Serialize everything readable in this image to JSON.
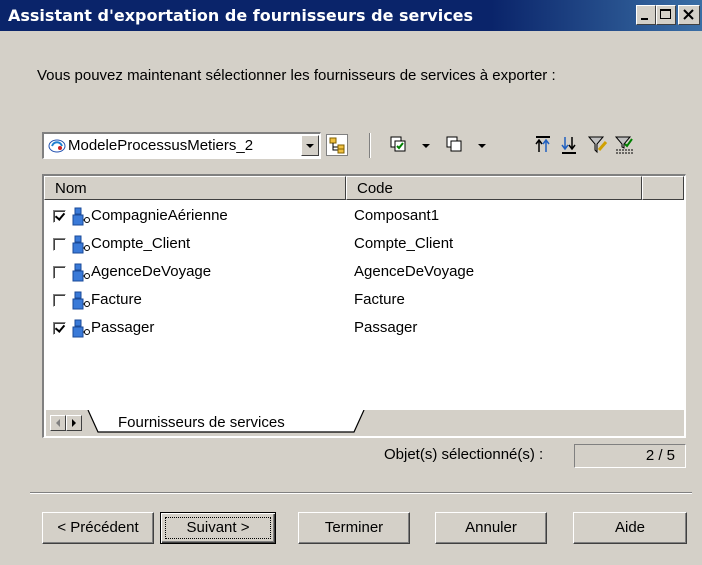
{
  "window": {
    "title": "Assistant d'exportation de fournisseurs de services",
    "controls": [
      "minimize-icon",
      "maximize-icon",
      "close-icon"
    ]
  },
  "instruction": "Vous pouvez maintenant sélectionner les fournisseurs de services à exporter :",
  "toolbar": {
    "model_selected": "ModeleProcessusMetiers_2",
    "tools": [
      "include-subpackages-icon",
      "select-all-icon",
      "deselect-all-icon",
      "move-to-top-icon",
      "move-to-bottom-icon",
      "filter-icon",
      "clear-filter-icon"
    ]
  },
  "list": {
    "columns": [
      "Nom",
      "Code"
    ],
    "rows": [
      {
        "name": "CompagnieAérienne",
        "code": "Composant1",
        "checked": true
      },
      {
        "name": "Compte_Client",
        "code": "Compte_Client",
        "checked": false
      },
      {
        "name": "AgenceDeVoyage",
        "code": "AgenceDeVoyage",
        "checked": false
      },
      {
        "name": "Facture",
        "code": "Facture",
        "checked": false
      },
      {
        "name": "Passager",
        "code": "Passager",
        "checked": true
      }
    ],
    "tab": "Fournisseurs de services"
  },
  "status": {
    "label": "Objet(s) sélectionné(s) :",
    "value": "2 / 5"
  },
  "buttons": {
    "back": "< Précédent",
    "next": "Suivant >",
    "finish": "Terminer",
    "cancel": "Annuler",
    "help": "Aide"
  },
  "colors": {
    "titlebar": "#0a246a",
    "face": "#d4d0c8",
    "component_icon": "#3a7ad8"
  }
}
